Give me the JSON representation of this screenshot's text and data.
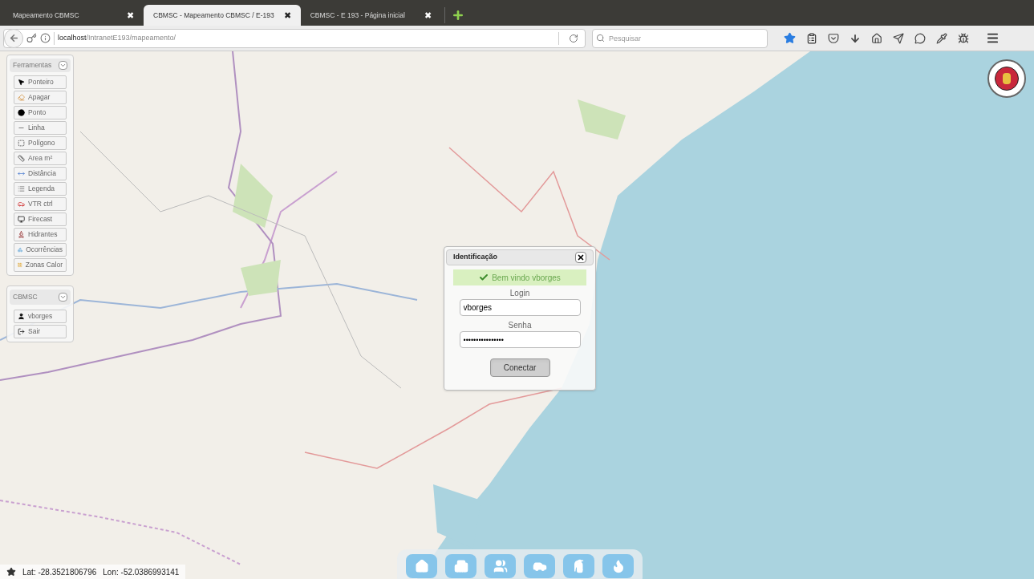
{
  "tabs": [
    {
      "title": "Mapeamento CBMSC",
      "close": "✖",
      "selected": false
    },
    {
      "title": "CBMSC - Mapeamento CBMSC / E-193",
      "close": "✖",
      "selected": true
    },
    {
      "title": "CBMSC - E 193 - Página inicial",
      "close": "✖",
      "selected": false
    }
  ],
  "address_bar": {
    "host": "localhost",
    "path": "/IntranetE193/mapeamento/"
  },
  "search": {
    "placeholder": "Pesquisar"
  },
  "tools_panel": {
    "title": "Ferramentas",
    "items": [
      "Ponteiro",
      "Apagar",
      "Ponto",
      "Linha",
      "Polígono",
      "Area m²",
      "Distância",
      "Legenda",
      "VTR ctrl",
      "Firecast",
      "Hidrantes",
      "Ocorrências",
      "Zonas Calor"
    ]
  },
  "user_panel": {
    "title": "CBMSC",
    "items": [
      "vborges",
      "Sair"
    ]
  },
  "dialog": {
    "title": "Identificação",
    "message": "Bem vindo vborges",
    "login_label": "Login",
    "login_value": "vborges",
    "password_label": "Senha",
    "password_value": "••••••••••••••••",
    "button": "Conectar"
  },
  "coordinates": {
    "lat": "Lat: -28.3521806796",
    "lon": "Lon: -52.0386993141"
  }
}
